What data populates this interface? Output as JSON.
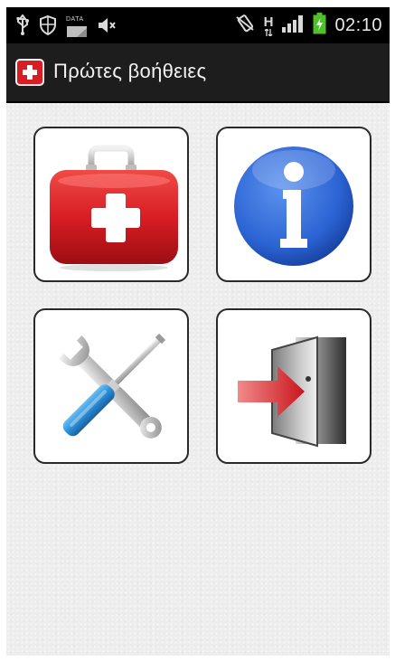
{
  "statusbar": {
    "time": "02:10",
    "data_label": "DATA",
    "network_type": "H",
    "icons": [
      "usb-icon",
      "shield-icon",
      "data-icon",
      "mute-icon",
      "vibrate-icon",
      "network-h-icon",
      "signal-icon",
      "battery-charging-icon"
    ]
  },
  "appbar": {
    "title": "Πρώτες βοήθειες",
    "icon": "first-aid-app-icon"
  },
  "menu": {
    "tiles": [
      {
        "icon": "first-aid-kit-icon"
      },
      {
        "icon": "info-icon"
      },
      {
        "icon": "tools-icon"
      },
      {
        "icon": "exit-door-icon"
      }
    ]
  },
  "colors": {
    "statusbar_bg": "#000000",
    "actionbar_bg": "#1d1d1d",
    "background": "#ededed",
    "kit_red": "#d81e24",
    "info_blue": "#2b63d3",
    "tool_blue": "#2a8fd8",
    "arrow_red": "#d8262c"
  }
}
